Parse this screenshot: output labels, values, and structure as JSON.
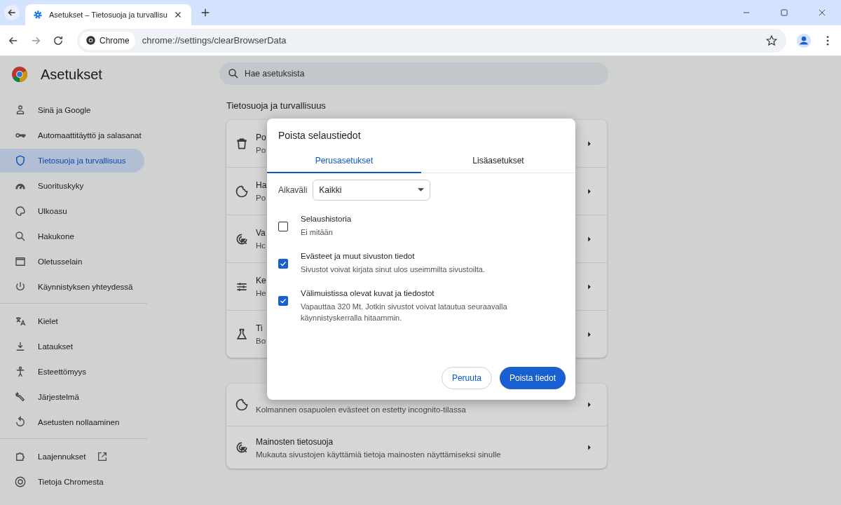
{
  "browser": {
    "tab": {
      "title": "Asetukset – Tietosuoja ja turvallisu"
    },
    "address": {
      "chip": "Chrome",
      "url": "chrome://settings/clearBrowserData"
    }
  },
  "settings": {
    "title": "Asetukset",
    "search": {
      "placeholder": "Hae asetuksista"
    },
    "sidebar": {
      "groups": [
        {
          "items": [
            {
              "label": "Sinä ja Google",
              "selected": false
            },
            {
              "label": "Automaattitäyttö ja salasanat",
              "selected": false
            },
            {
              "label": "Tietosuoja ja turvallisuus",
              "selected": true
            },
            {
              "label": "Suorituskyky",
              "selected": false
            },
            {
              "label": "Ulkoasu",
              "selected": false
            },
            {
              "label": "Hakukone",
              "selected": false
            },
            {
              "label": "Oletusselain",
              "selected": false
            },
            {
              "label": "Käynnistyksen yhteydessä",
              "selected": false
            }
          ]
        },
        {
          "items": [
            {
              "label": "Kielet",
              "selected": false
            },
            {
              "label": "Lataukset",
              "selected": false
            },
            {
              "label": "Esteettömyys",
              "selected": false
            },
            {
              "label": "Järjestelmä",
              "selected": false
            },
            {
              "label": "Asetusten nollaaminen",
              "selected": false
            }
          ]
        },
        {
          "items": [
            {
              "label": "Laajennukset",
              "selected": false,
              "external": true
            },
            {
              "label": "Tietoja Chromesta",
              "selected": false
            }
          ]
        }
      ]
    },
    "section_title": "Tietosuoja ja turvallisuus",
    "cards": [
      {
        "rows": [
          {
            "title": "Po",
            "subtitle": "Po"
          },
          {
            "title": "Ha",
            "subtitle": "Po"
          },
          {
            "title": "Va",
            "subtitle": "Hc"
          },
          {
            "title": "Ke",
            "subtitle": "He"
          },
          {
            "title": "Ti",
            "subtitle": "Bo"
          }
        ]
      },
      {
        "rows": [
          {
            "subtitle": "Kolmannen osapuolen evästeet on estetty incognito-tilassa"
          },
          {
            "title": "Mainosten tietosuoja",
            "subtitle": "Mukauta sivustojen käyttämiä tietoja mainosten näyttämiseksi sinulle"
          }
        ]
      }
    ]
  },
  "dialog": {
    "title": "Poista selaustiedot",
    "tabs": [
      {
        "label": "Perusasetukset",
        "selected": true
      },
      {
        "label": "Lisäasetukset",
        "selected": false
      }
    ],
    "time_range": {
      "label": "Aikaväli",
      "value": "Kaikki"
    },
    "options": [
      {
        "title": "Selaushistoria",
        "subtitle": "Ei mitään",
        "checked": false
      },
      {
        "title": "Evästeet ja muut sivuston tiedot",
        "subtitle": "Sivustot voivat kirjata sinut ulos useimmilta sivustoilta.",
        "checked": true
      },
      {
        "title": "Välimuistissa olevat kuvat ja tiedostot",
        "subtitle": "Vapauttaa 320 Mt. Jotkin sivustot voivat latautua seuraavalla käynnistyskerralla hitaammin.",
        "checked": true
      }
    ],
    "buttons": {
      "cancel": "Peruuta",
      "confirm": "Poista tiedot"
    }
  }
}
